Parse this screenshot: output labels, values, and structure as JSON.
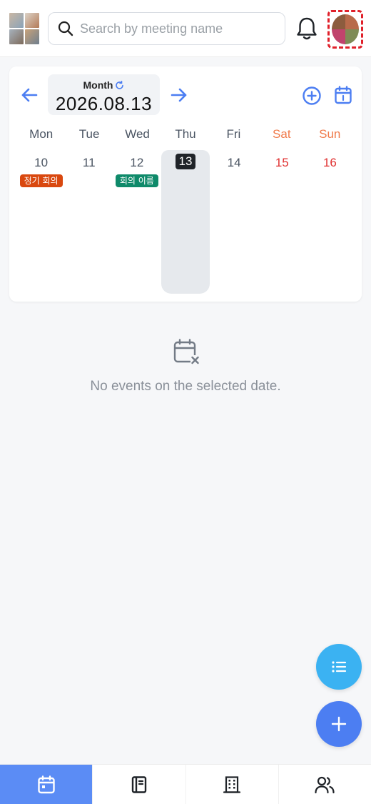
{
  "header": {
    "search": {
      "placeholder": "Search by meeting name",
      "value": ""
    },
    "icons": [
      "app-logo",
      "search-icon",
      "bell-icon",
      "profile-avatar"
    ]
  },
  "calendar": {
    "view_mode": "Month",
    "current_date": "2026.08.13",
    "weekdays": [
      "Mon",
      "Tue",
      "Wed",
      "Thu",
      "Fri",
      "Sat",
      "Sun"
    ],
    "days": [
      {
        "num": "10",
        "event": "정기 회의",
        "event_color": "#d9480f"
      },
      {
        "num": "11",
        "event": ""
      },
      {
        "num": "12",
        "event": "회의 이름",
        "event_color": "#0f8a6a"
      },
      {
        "num": "13",
        "event": "",
        "today": true
      },
      {
        "num": "14",
        "event": ""
      },
      {
        "num": "15",
        "event": ""
      },
      {
        "num": "16",
        "event": ""
      }
    ],
    "colors": {
      "accent": "#4c7ef2",
      "weekend_header": "#f07a4a",
      "weekend_date": "#e03131"
    }
  },
  "empty_state": {
    "text": "No events on the selected date."
  },
  "fabs": {
    "list_color": "#3bb2f2",
    "add_color": "#4c7ef2"
  },
  "bottom_nav": {
    "tabs": [
      {
        "icon": "calendar-icon",
        "active": true
      },
      {
        "icon": "notebook-icon",
        "active": false
      },
      {
        "icon": "building-icon",
        "active": false
      },
      {
        "icon": "users-icon",
        "active": false
      }
    ],
    "active_color": "#5b8cf5"
  }
}
